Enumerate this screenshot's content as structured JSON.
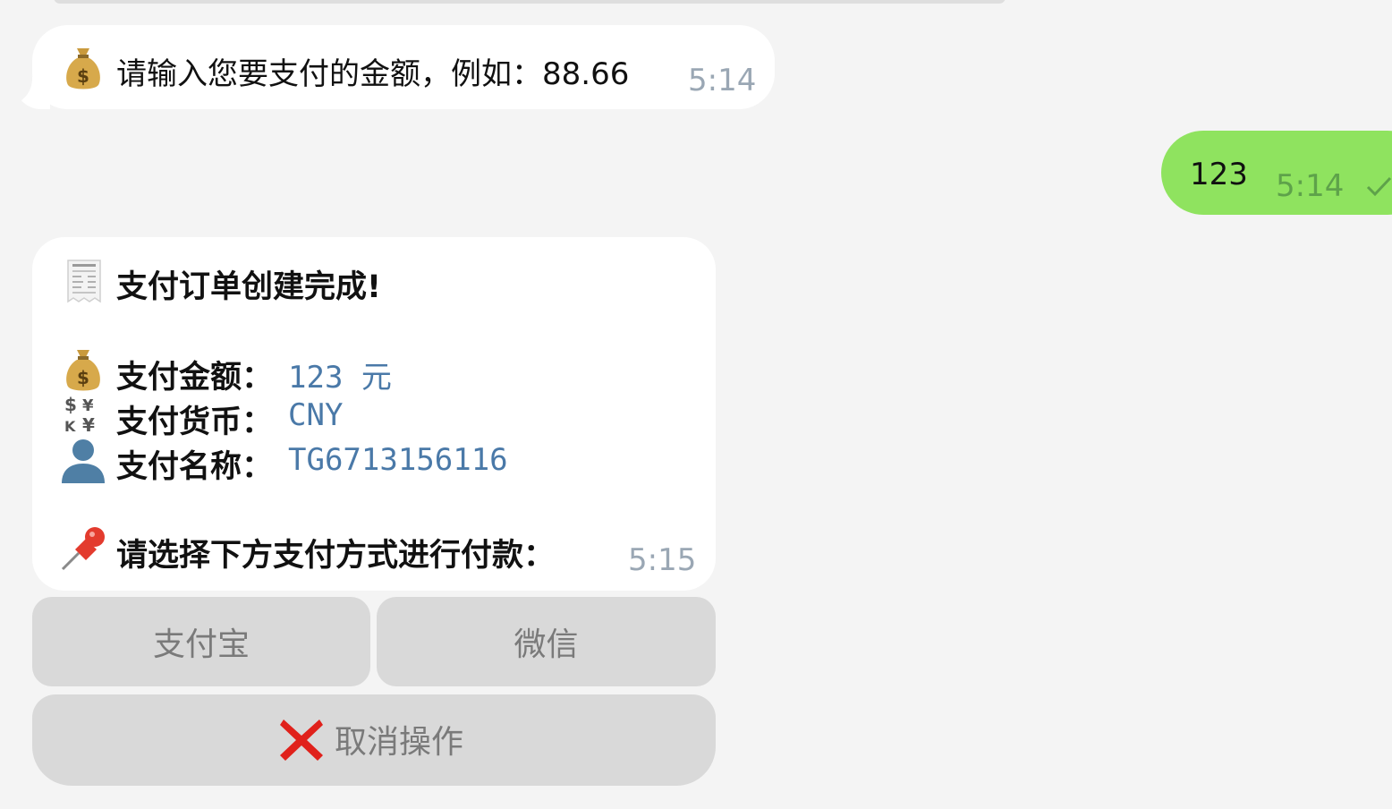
{
  "chat": {
    "message_1": {
      "icon": "money-bag-icon",
      "text": "请输入您要支付的金额，例如：88.66",
      "time": "5:14"
    },
    "message_2": {
      "text": "123",
      "time": "5:14",
      "status_icon": "check-icon"
    },
    "message_3": {
      "title_icon": "receipt-icon",
      "title": "支付订单创建完成!",
      "amount_icon": "money-bag-icon",
      "amount_label": "支付金额：",
      "amount_value": "123 元",
      "currency_icon": "currency-exchange-icon",
      "currency_label": "支付货币：",
      "currency_value": "CNY",
      "name_icon": "user-silhouette-icon",
      "name_label": "支付名称：",
      "name_value": "TG6713156116",
      "prompt_icon": "pushpin-icon",
      "prompt": "请选择下方支付方式进行付款：",
      "time": "5:15"
    }
  },
  "keyboard": {
    "alipay_label": "支付宝",
    "wechat_label": "微信",
    "cancel_icon": "cross-mark-icon",
    "cancel_label": "取消操作"
  },
  "colors": {
    "background": "#f4f4f4",
    "incoming_bubble": "#ffffff",
    "outgoing_bubble": "#8fe35f",
    "button": "#d9d9d9",
    "value_text": "#4a79a8",
    "cancel_cross": "#e0211b"
  }
}
